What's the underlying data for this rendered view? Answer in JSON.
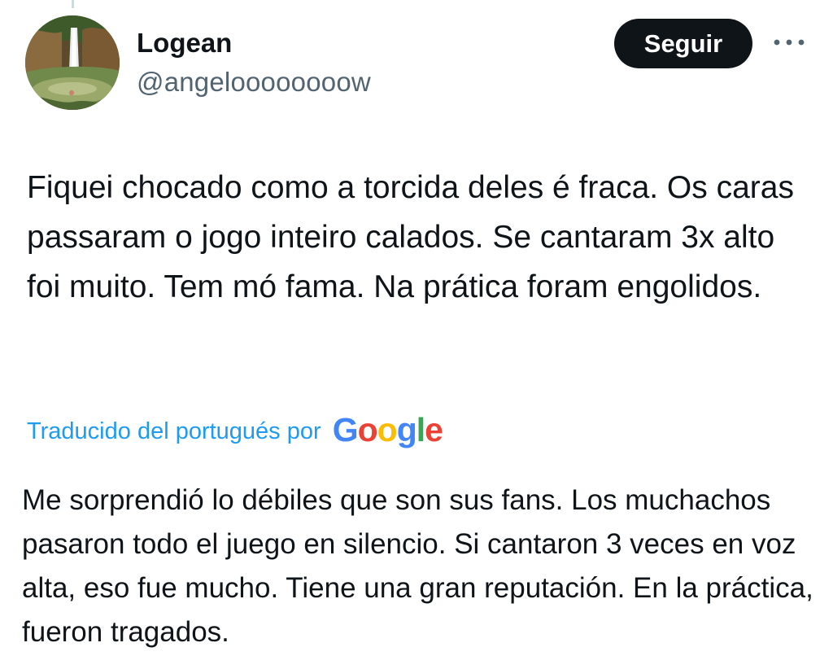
{
  "author": {
    "display_name": "Logean",
    "handle": "@angeloooooooow",
    "avatar_icon": "waterfall-avatar"
  },
  "actions": {
    "follow_label": "Seguir",
    "more_icon": "more-horizontal-icon"
  },
  "tweet": {
    "text": "Fiquei chocado como a torcida deles é fraca. Os caras passaram o jogo inteiro calados. Se cantaram 3x alto foi muito. Tem mó fama. Na prática foram engolidos."
  },
  "translation": {
    "label": "Traducido del portugués por",
    "provider": "Google",
    "text": "Me sorprendió lo débiles que son sus fans. Los muchachos pasaron todo el juego en silencio. Si cantaron 3 veces en voz alta, eso fue mucho. Tiene una gran reputación. En la práctica, fueron tragados."
  },
  "colors": {
    "text_primary": "#0f1419",
    "text_secondary": "#536471",
    "link_blue": "#1d9bf0",
    "button_bg": "#0f1419",
    "button_text": "#ffffff",
    "google_blue": "#4285f4",
    "google_red": "#ea4335",
    "google_yellow": "#fbbc05",
    "google_green": "#34a853"
  }
}
